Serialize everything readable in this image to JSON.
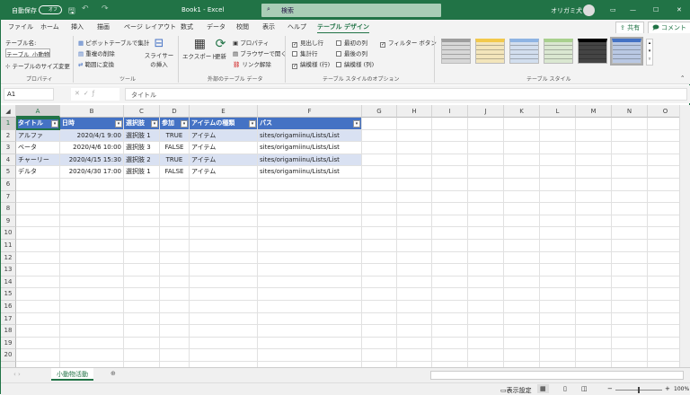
{
  "titlebar": {
    "autosave": "自動保存",
    "autosave_state": "オフ",
    "title": "Book1 - Excel",
    "search_placeholder": "検索",
    "user": "オリガミ犬"
  },
  "tabs": [
    "ファイル",
    "ホーム",
    "挿入",
    "描画",
    "ページ レイアウト",
    "数式",
    "データ",
    "校閲",
    "表示",
    "ヘルプ",
    "テーブル デザイン"
  ],
  "share": "共有",
  "comment": "コメント",
  "ribbon": {
    "properties": {
      "table_name_label": "テーブル名:",
      "table_name_value": "テーブル_小動物活",
      "resize": "テーブルのサイズ変更",
      "group": "プロパティ"
    },
    "tools": {
      "pivot": "ピボットテーブルで集計",
      "dedupe": "重複の削除",
      "convert": "範囲に変換",
      "slicer": "スライサーの挿入",
      "group": "ツール"
    },
    "external": {
      "export": "エクスポート",
      "refresh": "更新",
      "props": "プロパティ",
      "browser": "ブラウザーで開く",
      "unlink": "リンク解除",
      "group": "外部のテーブル データ"
    },
    "options": {
      "items": [
        {
          "label": "見出し行",
          "checked": true
        },
        {
          "label": "集計行",
          "checked": false
        },
        {
          "label": "縞模様 (行)",
          "checked": true
        },
        {
          "label": "最初の列",
          "checked": false
        },
        {
          "label": "最後の列",
          "checked": false
        },
        {
          "label": "縞模様 (列)",
          "checked": false
        },
        {
          "label": "フィルター ボタン",
          "checked": true
        }
      ],
      "group": "テーブル スタイルのオプション"
    },
    "styles": {
      "group": "テーブル スタイル",
      "colors": [
        "#9e9e9e",
        "#f2c94c",
        "#8fb4e3",
        "#a9d08e",
        "#000000",
        "#4472c4"
      ]
    }
  },
  "formula": {
    "namebox": "A1",
    "value": "タイトル"
  },
  "columns": [
    "A",
    "B",
    "C",
    "D",
    "E",
    "F",
    "G",
    "H",
    "I",
    "J",
    "K",
    "L",
    "M",
    "N",
    "O"
  ],
  "table": {
    "headers": [
      "タイトル",
      "日時",
      "選択肢",
      "参加",
      "アイテムの種類",
      "パス"
    ],
    "rows": [
      [
        "アルファ",
        "2020/4/1 9:00",
        "選択肢 1",
        "TRUE",
        "アイテム",
        "sites/origamiinu/Lists/List"
      ],
      [
        "ベータ",
        "2020/4/6 10:00",
        "選択肢 3",
        "FALSE",
        "アイテム",
        "sites/origamiinu/Lists/List"
      ],
      [
        "チャーリー",
        "2020/4/15 15:30",
        "選択肢 2",
        "TRUE",
        "アイテム",
        "sites/origamiinu/Lists/List"
      ],
      [
        "デルタ",
        "2020/4/30 17:00",
        "選択肢 1",
        "FALSE",
        "アイテム",
        "sites/origamiinu/Lists/List"
      ]
    ]
  },
  "row_numbers": [
    "1",
    "2",
    "3",
    "4",
    "5",
    "6",
    "7",
    "8",
    "9",
    "10",
    "11",
    "12",
    "13",
    "14",
    "15",
    "16",
    "17",
    "18",
    "19",
    "20"
  ],
  "sheet": {
    "name": "小動物活動"
  },
  "status": {
    "display": "表示設定",
    "zoom": "100%"
  }
}
